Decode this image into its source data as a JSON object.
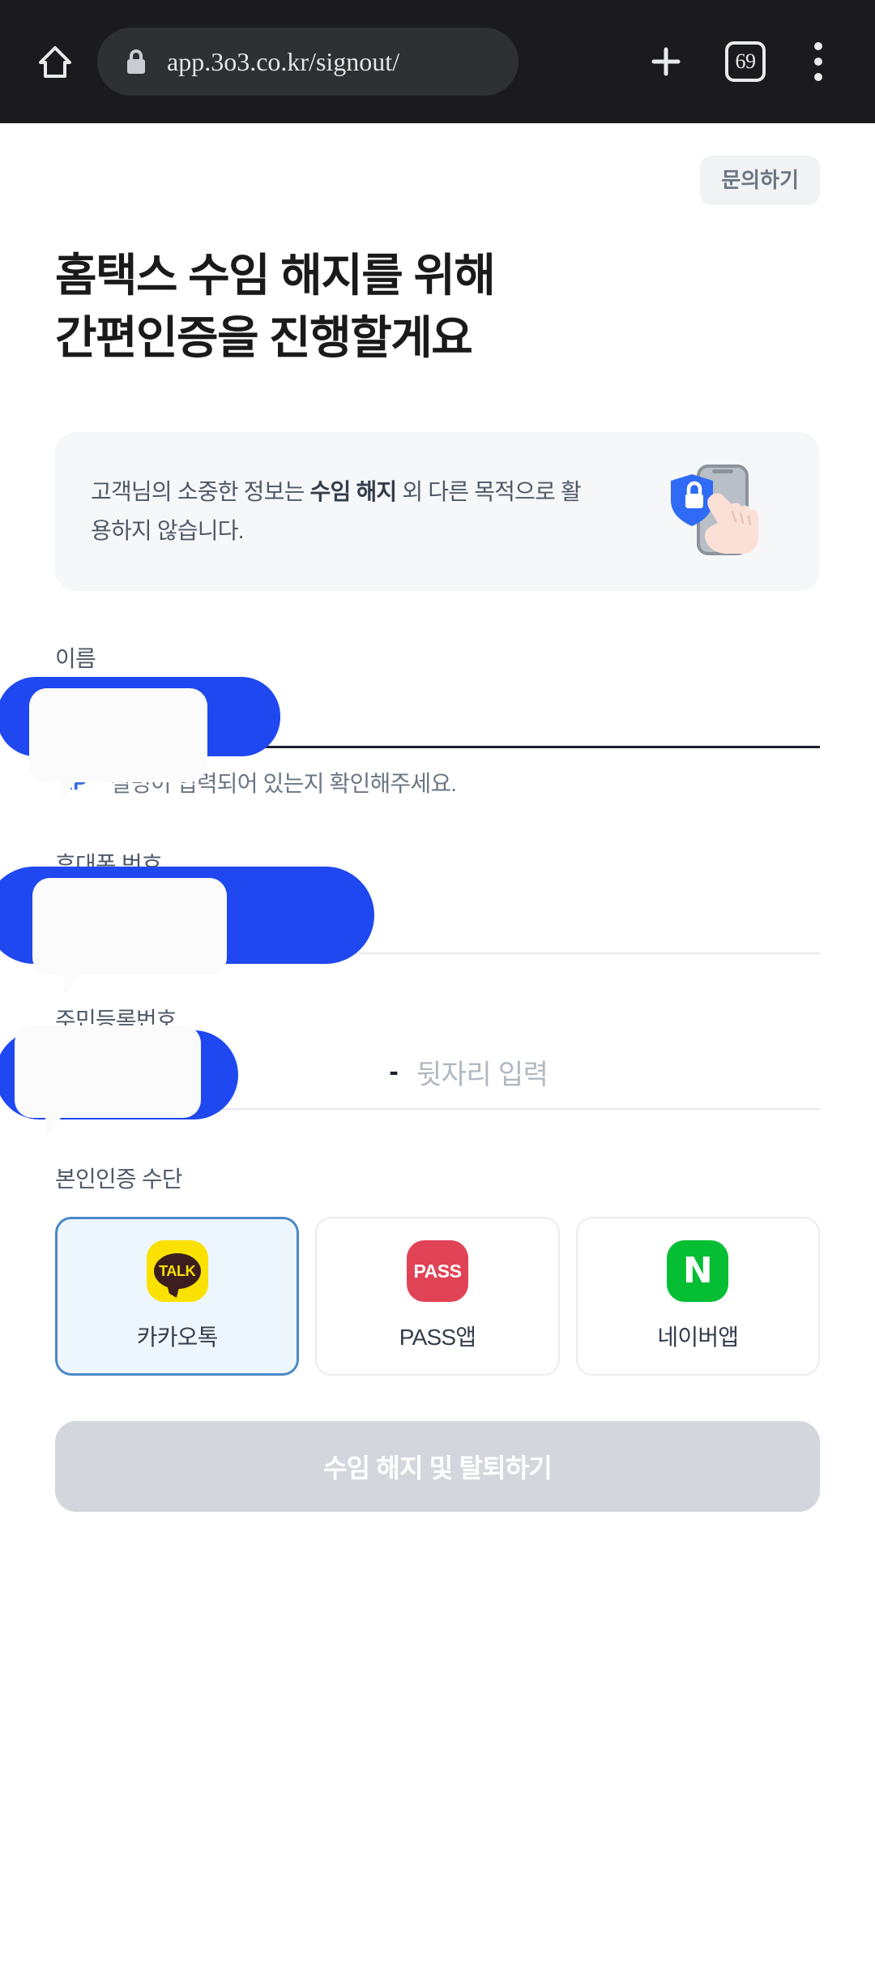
{
  "browser": {
    "home_icon": "home-icon",
    "lock_icon": "lock-icon",
    "url": "app.3o3.co.kr/signout/",
    "new_tab_label": "+",
    "tab_count": "69",
    "menu_icon": "three-dot-menu-icon"
  },
  "header": {
    "contact_button": "문의하기"
  },
  "title": {
    "line1": "홈택스 수임 해지를 위해",
    "line2": "간편인증을 진행할게요"
  },
  "notice": {
    "text_before": "고객님의 소중한 정보는 ",
    "text_bold": "수임 해지",
    "text_after": " 외 다른 목적으로 활용하지 않습니다.",
    "illustration": "phone-shield-lock-hand-illustration"
  },
  "fields": {
    "name": {
      "label": "이름",
      "value": "",
      "tip_badge": "TIP",
      "tip_text": "실명이 입력되어 있는지 확인해주세요."
    },
    "phone": {
      "label": "휴대폰 번호",
      "value": ""
    },
    "rrn": {
      "label": "주민등록번호",
      "front_value": "",
      "separator": "-",
      "back_placeholder": "뒷자리 입력"
    }
  },
  "auth": {
    "label": "본인인증 수단",
    "options": [
      {
        "id": "kakao",
        "label": "카카오톡",
        "icon_text": "TALK",
        "icon": "kakaotalk-icon",
        "selected": true
      },
      {
        "id": "pass",
        "label": "PASS앱",
        "icon_text": "PASS",
        "icon": "pass-app-icon",
        "selected": false
      },
      {
        "id": "naver",
        "label": "네이버앱",
        "icon_text": "N",
        "icon": "naver-app-icon",
        "selected": false
      }
    ]
  },
  "submit": {
    "label": "수임 해지 및 탈퇴하기",
    "disabled": true
  },
  "colors": {
    "accent_blue": "#1f48f0",
    "kakao_yellow": "#fae100",
    "pass_red": "#e04356",
    "naver_green": "#06be34",
    "selected_border": "#4b89c8",
    "disabled_button": "#d3d7dd"
  }
}
